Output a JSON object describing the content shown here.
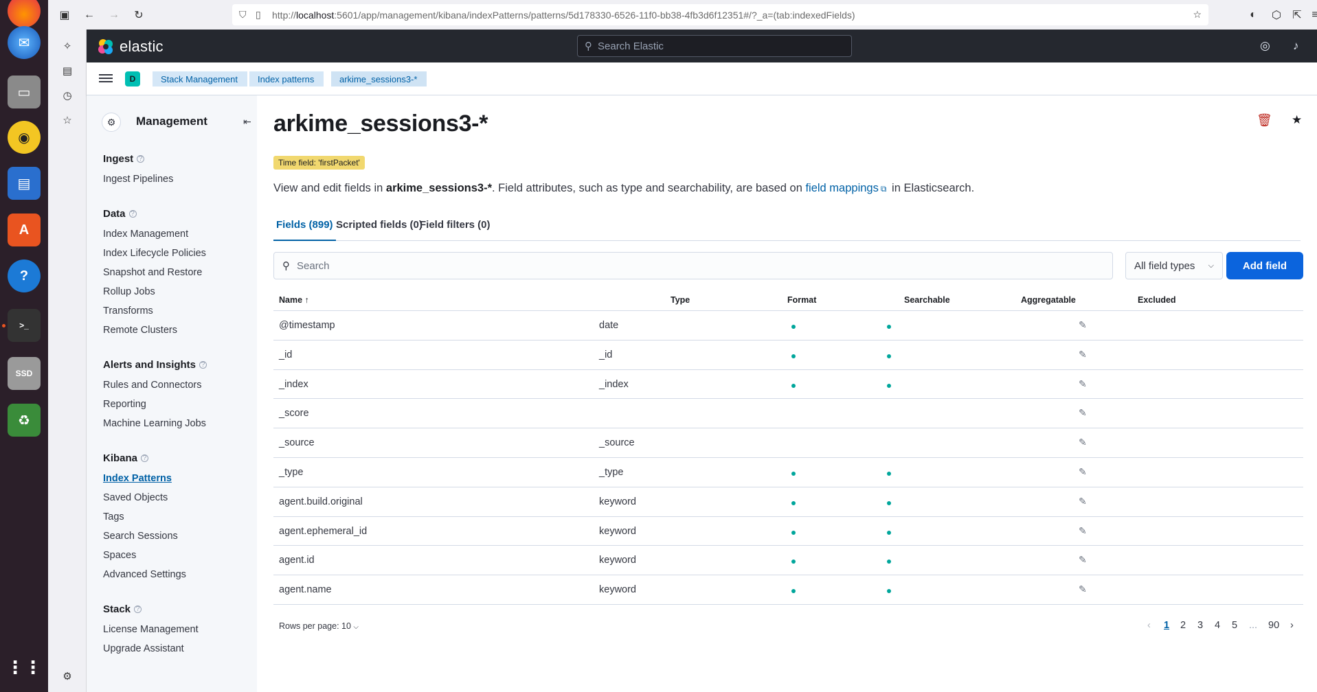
{
  "browser": {
    "url_prefix": "http://",
    "url_host": "localhost",
    "url_rest": ":5601/app/management/kibana/indexPatterns/patterns/5d178330-6526-11f0-bb38-4fb3d6f12351#/?_a=(tab:indexedFields)"
  },
  "header": {
    "brand": "elastic",
    "search_placeholder": "Search Elastic"
  },
  "breadcrumbs": {
    "space_initial": "D",
    "items": [
      "Stack Management",
      "Index patterns",
      "arkime_sessions3-*"
    ]
  },
  "sidebar": {
    "title": "Management",
    "sections": [
      {
        "title": "Ingest",
        "items": [
          "Ingest Pipelines"
        ]
      },
      {
        "title": "Data",
        "items": [
          "Index Management",
          "Index Lifecycle Policies",
          "Snapshot and Restore",
          "Rollup Jobs",
          "Transforms",
          "Remote Clusters"
        ]
      },
      {
        "title": "Alerts and Insights",
        "items": [
          "Rules and Connectors",
          "Reporting",
          "Machine Learning Jobs"
        ]
      },
      {
        "title": "Kibana",
        "items": [
          "Index Patterns",
          "Saved Objects",
          "Tags",
          "Search Sessions",
          "Spaces",
          "Advanced Settings"
        ]
      },
      {
        "title": "Stack",
        "items": [
          "License Management",
          "Upgrade Assistant"
        ]
      }
    ],
    "active_item": "Index Patterns"
  },
  "main": {
    "title": "arkime_sessions3-*",
    "time_field_badge": "Time field: 'firstPacket'",
    "description": {
      "prefix": "View and edit fields in ",
      "pattern": "arkime_sessions3-*",
      "middle": ". Field attributes, such as type and searchability, are based on ",
      "link": "field mappings",
      "suffix": " in Elasticsearch."
    },
    "tabs": [
      "Fields (899)",
      "Scripted fields (0)",
      "Field filters (0)"
    ],
    "search_placeholder": "Search",
    "type_filter": "All field types",
    "add_field_label": "Add field",
    "columns": [
      "Name",
      "Type",
      "Format",
      "Searchable",
      "Aggregatable",
      "Excluded"
    ],
    "rows": [
      {
        "name": "@timestamp",
        "type": "date",
        "format": "",
        "searchable": true,
        "aggregatable": true
      },
      {
        "name": "_id",
        "type": "_id",
        "format": "",
        "searchable": true,
        "aggregatable": true
      },
      {
        "name": "_index",
        "type": "_index",
        "format": "",
        "searchable": true,
        "aggregatable": true
      },
      {
        "name": "_score",
        "type": "",
        "format": "",
        "searchable": false,
        "aggregatable": false
      },
      {
        "name": "_source",
        "type": "_source",
        "format": "",
        "searchable": false,
        "aggregatable": false
      },
      {
        "name": "_type",
        "type": "_type",
        "format": "",
        "searchable": true,
        "aggregatable": true
      },
      {
        "name": "agent.build.original",
        "type": "keyword",
        "format": "",
        "searchable": true,
        "aggregatable": true
      },
      {
        "name": "agent.ephemeral_id",
        "type": "keyword",
        "format": "",
        "searchable": true,
        "aggregatable": true
      },
      {
        "name": "agent.id",
        "type": "keyword",
        "format": "",
        "searchable": true,
        "aggregatable": true
      },
      {
        "name": "agent.name",
        "type": "keyword",
        "format": "",
        "searchable": true,
        "aggregatable": true
      }
    ],
    "rows_per_page": "Rows per page: 10",
    "pages": [
      "1",
      "2",
      "3",
      "4",
      "5",
      "...",
      "90"
    ],
    "current_page": "1"
  },
  "colors": {
    "accent": "#0061a6",
    "dot": "#00a69b",
    "badge": "#f1d86f",
    "primary_button": "#0b64dd"
  }
}
